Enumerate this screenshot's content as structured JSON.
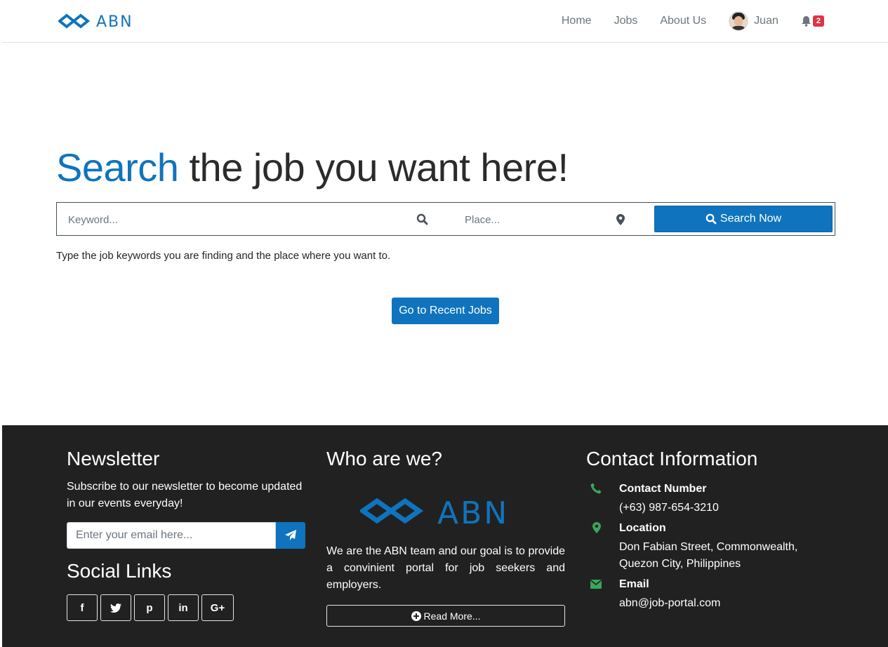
{
  "brand": {
    "name": "ABN",
    "color": "#0f74bd"
  },
  "nav": {
    "items": [
      {
        "label": "Home"
      },
      {
        "label": "Jobs"
      },
      {
        "label": "About Us"
      }
    ],
    "user": {
      "name": "Juan"
    },
    "notifications": {
      "count": "2"
    }
  },
  "hero": {
    "title_accent": "Search",
    "title_rest": " the job you want here!",
    "keyword_placeholder": "Keyword...",
    "place_placeholder": "Place...",
    "search_button": "Search Now",
    "hint": "Type the job keywords you are finding and the place where you want to.",
    "recent_button": "Go to Recent Jobs"
  },
  "footer": {
    "newsletter": {
      "title": "Newsletter",
      "text": "Subscribe to our newsletter to become updated in our events everyday!",
      "email_placeholder": "Enter your email here..."
    },
    "social": {
      "title": "Social Links",
      "links": [
        {
          "glyph": "f",
          "icon": "facebook-icon"
        },
        {
          "glyph": "t",
          "icon": "twitter-icon"
        },
        {
          "glyph": "p",
          "icon": "pinterest-icon"
        },
        {
          "glyph": "in",
          "icon": "linkedin-icon"
        },
        {
          "glyph": "G+",
          "icon": "google-plus-icon"
        }
      ]
    },
    "who": {
      "title": "Who are we?",
      "text": "We are the ABN team and our goal is to provide a convinient portal for job seekers and employers.",
      "read_more": "Read More..."
    },
    "contact": {
      "title": "Contact Information",
      "number_label": "Contact Number",
      "number_value": "(+63) 987-654-3210",
      "location_label": "Location",
      "location_line1": "Don Fabian Street, Commonwealth,",
      "location_line2": "Quezon City, Philippines",
      "email_label": "Email",
      "email_value": "abn@job-portal.com"
    }
  },
  "colors": {
    "accent": "#0f74bd",
    "footer_bg": "#212121",
    "contact_icon": "#3aa55d",
    "badge": "#dc3545"
  }
}
